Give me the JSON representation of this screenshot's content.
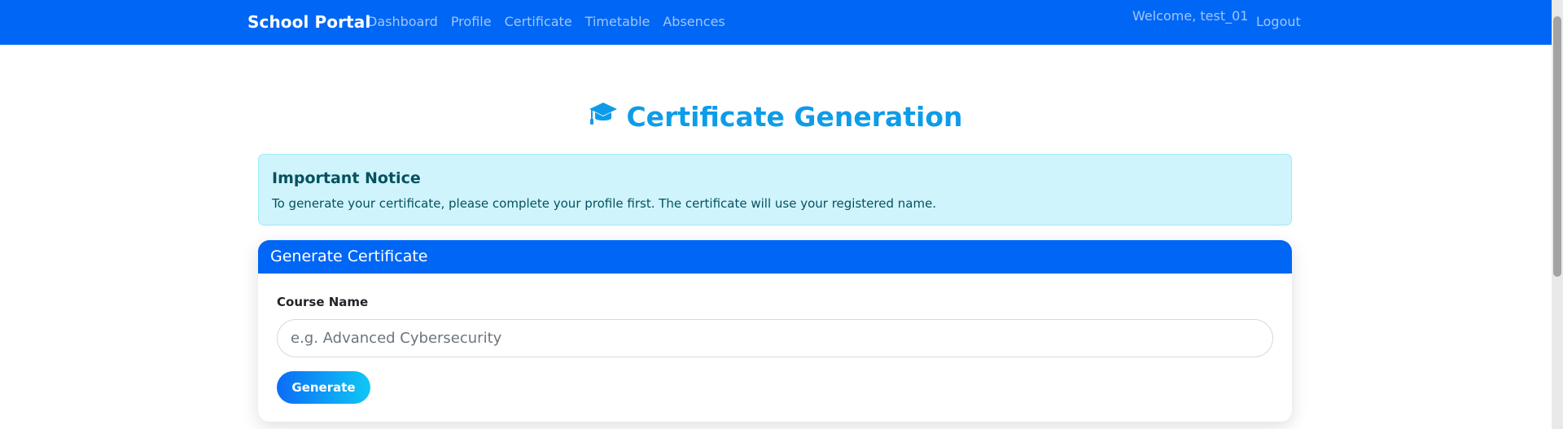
{
  "navbar": {
    "brand": "School Portal",
    "links": [
      {
        "label": "Dashboard"
      },
      {
        "label": "Profile"
      },
      {
        "label": "Certificate"
      },
      {
        "label": "Timetable"
      },
      {
        "label": "Absences"
      }
    ],
    "welcome": "Welcome, test_01",
    "logout": "Logout"
  },
  "page": {
    "title": "Certificate Generation",
    "title_icon": "graduation-cap-icon"
  },
  "notice": {
    "title": "Important Notice",
    "text": "To generate your certificate, please complete your profile first. The certificate will use your registered name."
  },
  "form": {
    "header": "Generate Certificate",
    "course_label": "Course Name",
    "course_value": "",
    "course_placeholder": "e.g. Advanced Cybersecurity",
    "submit_label": "Generate"
  },
  "colors": {
    "primary": "#0066f5",
    "heading": "#0e9ce8",
    "alert_bg": "#cff4fc",
    "alert_text": "#055160"
  }
}
